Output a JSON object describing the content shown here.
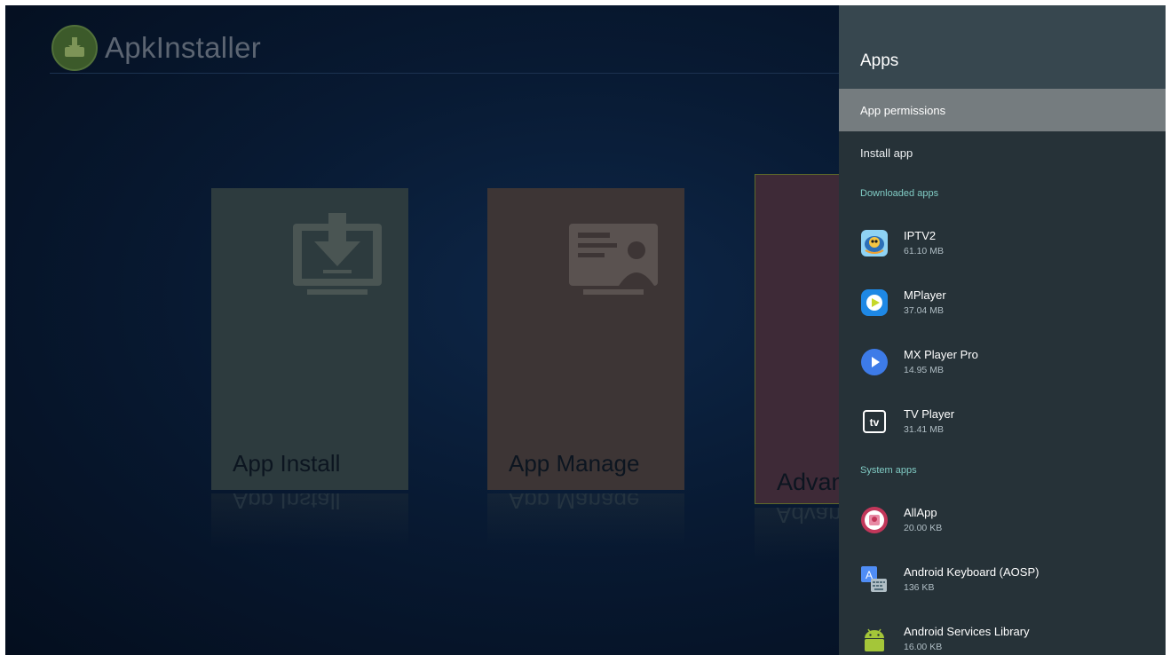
{
  "background_app": {
    "title": "ApkInstaller",
    "tiles": [
      {
        "label": "App Install",
        "icon": "download-to-screen-icon"
      },
      {
        "label": "App Manage",
        "icon": "app-manage-icon"
      },
      {
        "label": "Advan"
      }
    ]
  },
  "panel": {
    "title": "Apps",
    "menu": [
      {
        "label": "App permissions",
        "selected": true
      },
      {
        "label": "Install app",
        "selected": false
      }
    ],
    "sections": [
      {
        "header": "Downloaded apps",
        "apps": [
          {
            "name": "IPTV2",
            "size": "61.10 MB",
            "icon": "iptv2-icon"
          },
          {
            "name": "MPlayer",
            "size": "37.04 MB",
            "icon": "mplayer-icon"
          },
          {
            "name": "MX Player Pro",
            "size": "14.95 MB",
            "icon": "mx-player-icon"
          },
          {
            "name": "TV Player",
            "size": "31.41 MB",
            "icon": "tv-player-icon"
          }
        ]
      },
      {
        "header": "System apps",
        "apps": [
          {
            "name": "AllApp",
            "size": "20.00 KB",
            "icon": "allapp-icon"
          },
          {
            "name": "Android Keyboard (AOSP)",
            "size": "136 KB",
            "icon": "keyboard-icon"
          },
          {
            "name": "Android Services Library",
            "size": "16.00 KB",
            "icon": "android-icon"
          }
        ]
      }
    ]
  },
  "colors": {
    "panel_bg": "#263238",
    "panel_header": "#37474f",
    "selected_row": "#757c7f",
    "section_header_text": "#80cbc4"
  }
}
